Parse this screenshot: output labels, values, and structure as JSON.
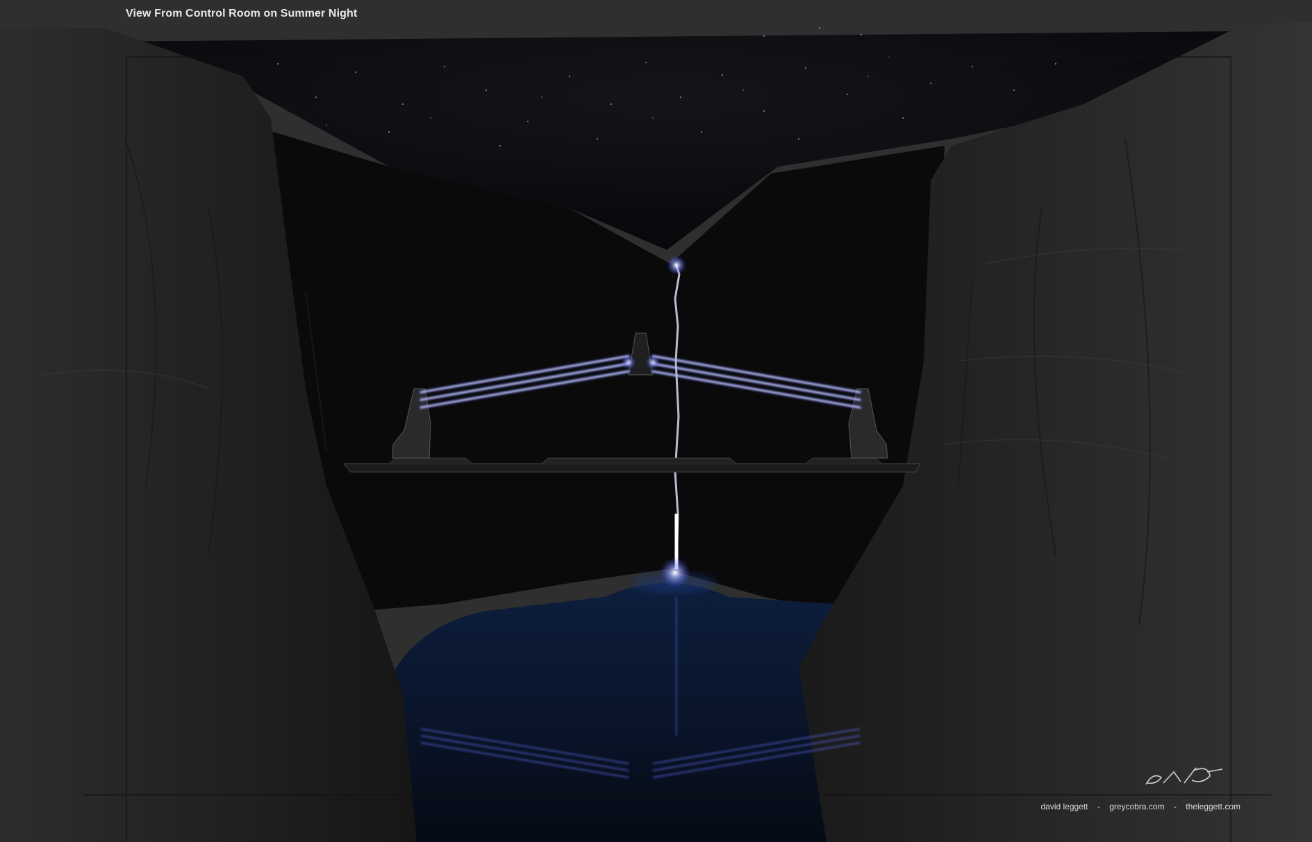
{
  "artwork": {
    "title": "View From Control Room on Summer Night",
    "signature": "David Leggett",
    "credits": {
      "artist": "david leggett",
      "separator": "-",
      "site_1": "greycobra.com",
      "site_2": "theleggett.com"
    }
  },
  "colors": {
    "background": "#2f2f2f",
    "rock": "#232323",
    "sky": "#0c0c10",
    "water": "#0b1a33",
    "light_beam": "#6a78ff"
  }
}
